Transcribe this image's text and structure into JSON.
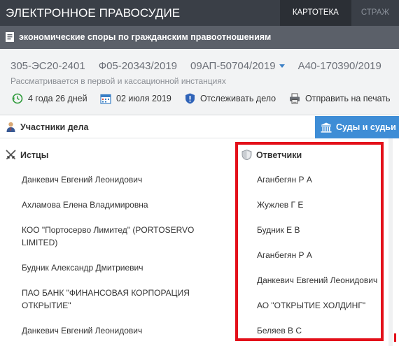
{
  "header": {
    "brand": "ЭЛЕКТРОННОЕ ПРАВОСУДИЕ",
    "nav": [
      {
        "label": "КАРТОТЕКА"
      },
      {
        "label": "СТРАЖ"
      }
    ]
  },
  "category": {
    "label": "экономические споры по гражданским правоотношениям"
  },
  "case": {
    "numbers": [
      "305-ЭС20-2401",
      "Ф05-20343/2019",
      "09АП-50704/2019",
      "А40-170390/2019"
    ],
    "subtitle": "Рассматривается в первой и кассационной инстанциях",
    "actions": {
      "duration": "4 года 26 дней",
      "date": "02 июля 2019",
      "track": "Отслеживать дело",
      "print": "Отправить на печать"
    }
  },
  "tabs": {
    "participants": "Участники дела",
    "courts": "Суды и судьи"
  },
  "plaintiffs": {
    "heading": "Истцы",
    "items": [
      [
        "Данкевич Евгений Леонидович"
      ],
      [
        "Ахламова Елена Владимировна"
      ],
      [
        "КОО \"Портосерво Лимитед\" (PORTOSERVO",
        "LIMITED)"
      ],
      [
        "Будник Александр Дмитриевич"
      ],
      [
        "ПАО БАНК \"ФИНАНСОВАЯ КОРПОРАЦИЯ",
        "ОТКРЫТИЕ\""
      ],
      [
        "Данкевич Евгений Леонидович"
      ]
    ]
  },
  "defendants": {
    "heading": "Ответчики",
    "items": [
      "Аганбегян Р А",
      "Жужлев Г Е",
      "Будник Е В",
      "Аганбегян Р А",
      "Данкевич Евгений Леонидович",
      "АО \"ОТКРЫТИЕ ХОЛДИНГ\"",
      "Беляев В С"
    ]
  },
  "colors": {
    "topbar": "#3a3f47",
    "category_bar": "#5b6069",
    "accent_blue": "#3e8dd6",
    "highlight_red": "#e3101a"
  }
}
